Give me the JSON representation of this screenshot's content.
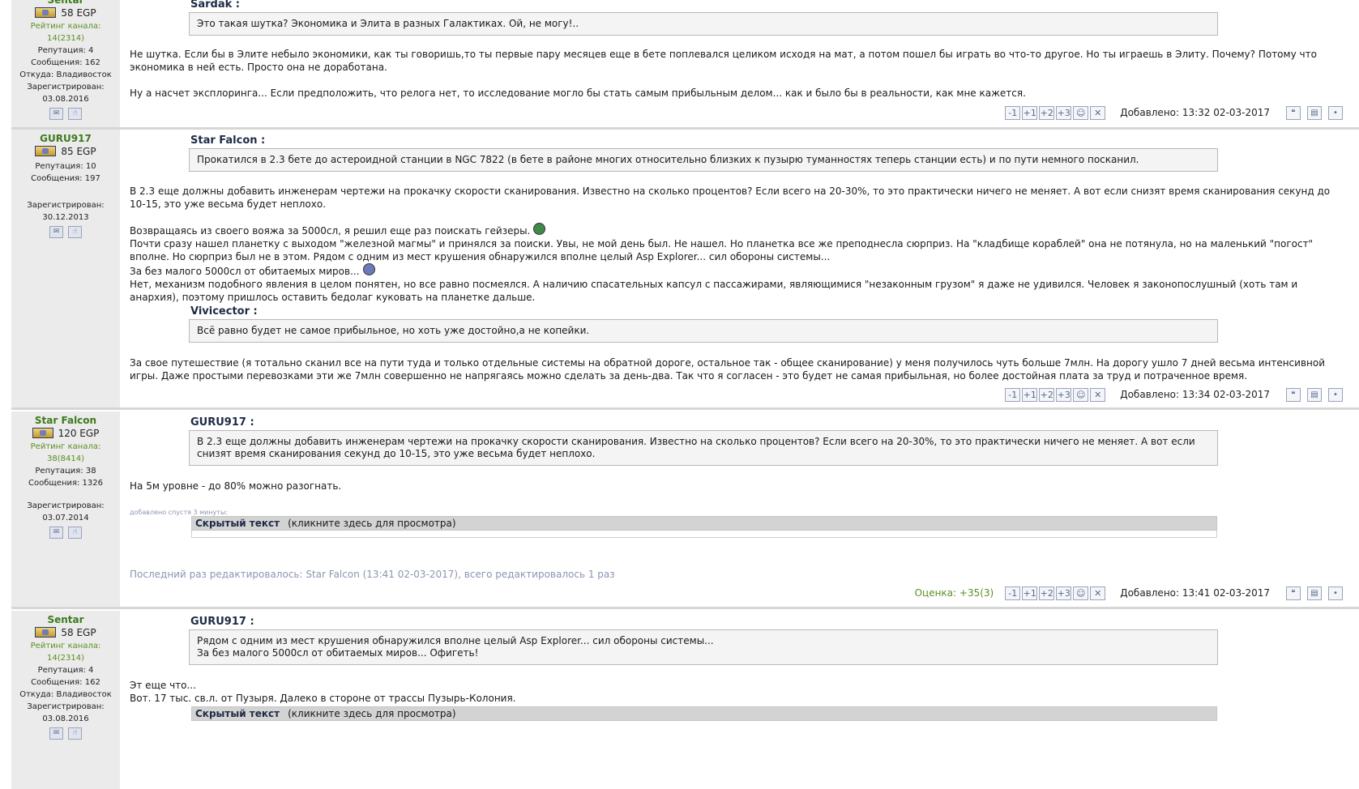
{
  "posts": [
    {
      "user": {
        "name": "Sentar",
        "egp": "58 EGP",
        "rating": "Рейтинг канала: 14(2314)",
        "reputation": "Репутация: 4",
        "messages": "Сообщения: 162",
        "from": "Откуда: Владивосток",
        "registered_label": "Зарегистрирован:",
        "registered": "03.08.2016"
      },
      "quote_author": "Sardak :",
      "quote": "Это такая шутка? Экономика и Элита в разных Галактиках. Ой, не могу!..",
      "paragraphs": [
        "Не шутка. Если бы в Элите небыло экономики, как ты говоришь,то ты первые пару месяцев еще в бете поплевался целиком исходя на мат, а потом пошел бы играть во что-то другое. Но ты играешь в Элиту. Почему? Потому что экономика в ней есть. Просто она не доработана.",
        "Ну а насчет эксплоринга... Если предположить, что релога нет, то исследование могло бы стать самым прибыльным делом... как и было бы в реальности, как мне кажется."
      ],
      "added": "Добавлено: 13:32 02-03-2017"
    },
    {
      "user": {
        "name": "GURU917",
        "egp": "85 EGP",
        "reputation": "Репутация: 10",
        "messages": "Сообщения: 197",
        "registered_label": "Зарегистрирован:",
        "registered": "30.12.2013"
      },
      "quote_author": "Star Falcon :",
      "quote": "Прокатился в 2.3 бете до астероидной станции в NGC 7822 (в бете в районе многих относительно близких к пузырю туманностях теперь станции есть) и по пути немного посканил.",
      "p1": "В 2.3 еще должны добавить инженерам чертежи на прокачку скорости сканирования. Известно на сколько процентов? Если всего на 20-30%, то это практически ничего не меняет. А вот если снизят время сканирования секунд до 10-15, это уже весьма будет неплохо.",
      "p2a": "Возвращаясь из своего вояжа за 5000сл, я решил еще раз поискать гейзеры.",
      "p2b": "Почти сразу нашел планетку с выходом \"железной магмы\" и принялся за поиски. Увы, не мой день был. Не нашел. Но планетка все же преподнесла сюрприз. На \"кладбище кораблей\" она не потянула, но на маленький \"погост\" вполне. Но сюрприз был не в этом. Рядом с одним из мест крушения обнаружился вполне целый Asp Explorer... сил обороны системы...",
      "p2c": "За без малого 5000сл от обитаемых миров...",
      "p2d": "Нет, механизм подобного явления в целом понятен, но все равно посмеялся. А наличию спасательных капсул с пассажирами, являющимися \"незаконным грузом\" я даже не удивился. Человек я законопослушный (хоть там и анархия), поэтому пришлось оставить бедолаг куковать на планетке дальше.",
      "quote2_author": "Vivicector :",
      "quote2": "Всё равно будет не самое прибыльное, но хоть уже достойно,а не копейки.",
      "p3": "За свое путешествие (я тотально сканил все на пути туда и только отдельные системы на обратной дороге, остальное так - общее сканирование) у меня получилось чуть больше 7млн. На дорогу ушло 7 дней весьма интенсивной игры. Даже простыми перевозками эти же 7млн совершенно не напрягаясь можно сделать за день-два. Так что я согласен - это будет не самая прибыльная, но более достойная плата за труд и потраченное время.",
      "added": "Добавлено: 13:34 02-03-2017"
    },
    {
      "user": {
        "name": "Star Falcon",
        "egp": "120 EGP",
        "rating": "Рейтинг канала: 38(8414)",
        "reputation": "Репутация: 38",
        "messages": "Сообщения: 1326",
        "registered_label": "Зарегистрирован:",
        "registered": "03.07.2014"
      },
      "quote_author": "GURU917 :",
      "quote": "В 2.3 еще должны добавить инженерам чертежи на прокачку скорости сканирования. Известно на сколько процентов? Если всего на 20-30%, то это практически ничего не меняет. А вот если снизят время сканирования секунд до 10-15, это уже весьма будет неплохо.",
      "p1": "На 5м уровне - до 80% можно разогнать.",
      "added_later": "добавлено спустя 3 минуты:",
      "hidden_title": "Скрытый текст",
      "hidden_hint": "(кликните здесь для просмотра)",
      "edited": "Последний раз редактировалось: Star Falcon (13:41 02-03-2017), всего редактировалось 1 раз",
      "score": "Оценка: +35(3)",
      "added": "Добавлено: 13:41 02-03-2017"
    },
    {
      "user": {
        "name": "Sentar",
        "egp": "58 EGP",
        "rating": "Рейтинг канала: 14(2314)",
        "reputation": "Репутация: 4",
        "messages": "Сообщения: 162",
        "from": "Откуда: Владивосток",
        "registered_label": "Зарегистрирован:",
        "registered": "03.08.2016"
      },
      "quote_author": "GURU917 :",
      "quote_l1": "Рядом с одним из мест крушения обнаружился вполне целый Asp Explorer... сил обороны системы...",
      "quote_l2": "За без малого 5000сл от обитаемых миров... Офигеть!",
      "p1": "Эт еще что...",
      "p2": "Вот. 17 тыс. св.л. от Пузыря. Далеко в стороне от трассы Пузырь-Колония.",
      "hidden_title": "Скрытый текст",
      "hidden_hint": "(кликните здесь для просмотра)"
    }
  ],
  "vote_buttons": [
    "-1",
    "+1",
    "+2",
    "+3"
  ],
  "icons": [
    "egp-badge-icon",
    "pm-icon",
    "thumb-icon",
    "smiley-icon",
    "close-icon",
    "quote-icon",
    "edit-icon",
    "up-icon"
  ]
}
